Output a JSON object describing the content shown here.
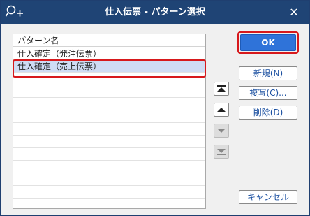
{
  "window": {
    "title": "仕入伝票 - パターン選択",
    "close_label": "✕"
  },
  "list": {
    "header": "パターン名",
    "rows": [
      "仕入確定（発注伝票）",
      "仕入確定（売上伝票）"
    ],
    "selected_index": 1
  },
  "buttons": {
    "ok": "OK",
    "new": "新規(N)",
    "copy": "複写(C)...",
    "delete": "削除(D)",
    "cancel": "キャンセル"
  },
  "reorder": {
    "top_icon": "move-to-top-icon",
    "up_icon": "move-up-icon",
    "down_icon": "move-down-icon",
    "bottom_icon": "move-to-bottom-icon"
  },
  "colors": {
    "titlebar": "#1f4475",
    "ok_button": "#2f73d9",
    "selection": "#cfdcf4",
    "highlight": "#d7191c",
    "button_text": "#1a4fa0"
  }
}
